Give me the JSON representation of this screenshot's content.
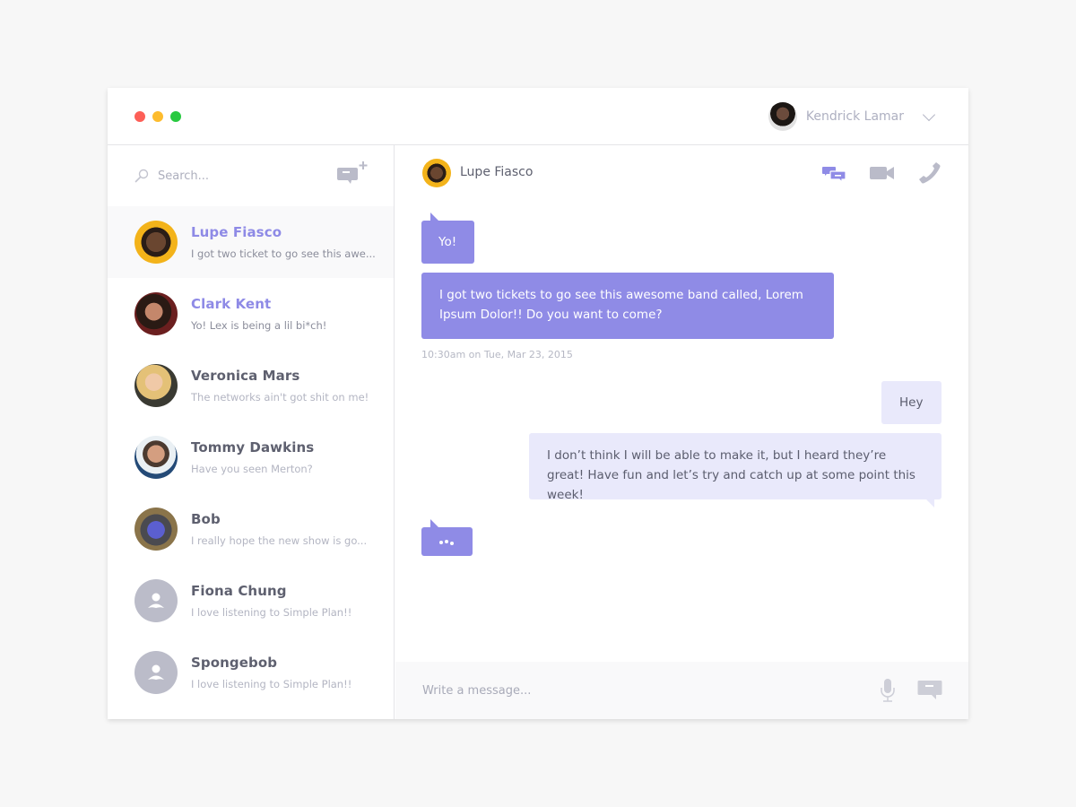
{
  "window": {
    "controls": [
      "close",
      "minimize",
      "maximize"
    ],
    "colors": {
      "close": "#fd5f57",
      "minimize": "#fdbc2e",
      "maximize": "#28c940"
    }
  },
  "user": {
    "name": "Kendrick Lamar",
    "menu_icon": "chevron-down-icon"
  },
  "sidebar": {
    "search": {
      "placeholder": "Search...",
      "value": ""
    },
    "new_chat_icon": "new-chat-icon",
    "contacts": [
      {
        "name": "Lupe Fiasco",
        "preview": "I got two ticket to go see this awe...",
        "active": true,
        "unread": true
      },
      {
        "name": "Clark Kent",
        "preview": "Yo! Lex is being a lil bi*ch!",
        "active": false,
        "unread": true
      },
      {
        "name": "Veronica Mars",
        "preview": "The networks ain't got shit on me!",
        "active": false,
        "unread": false
      },
      {
        "name": "Tommy Dawkins",
        "preview": "Have you seen Merton?",
        "active": false,
        "unread": false
      },
      {
        "name": "Bob",
        "preview": "I really hope the new show is go...",
        "active": false,
        "unread": false
      },
      {
        "name": "Fiona Chung",
        "preview": "I love listening to Simple Plan!!",
        "active": false,
        "unread": false
      },
      {
        "name": "Spongebob",
        "preview": "I love listening to Simple Plan!!",
        "active": false,
        "unread": false
      }
    ]
  },
  "chat": {
    "contact_name": "Lupe Fiasco",
    "actions": [
      "chat-icon",
      "video-camera-icon",
      "phone-icon"
    ],
    "messages": [
      {
        "from": "them",
        "text": "Yo!"
      },
      {
        "from": "them",
        "text": "I got two tickets to go see this awesome band called, Lorem Ipsum Dolor!! Do you want to come?"
      },
      {
        "from": "me",
        "text": "Hey"
      },
      {
        "from": "me",
        "text": "I don’t think I will be able to make it, but I heard they’re great! Have fun and let’s try and catch up at some point this week!"
      }
    ],
    "timestamp": "10:30am on Tue, Mar 23, 2015",
    "typing_indicator": "...",
    "composer": {
      "placeholder": "Write a message...",
      "value": ""
    }
  },
  "colors": {
    "accent": "#8f8be6",
    "outgoing_bubble": "#e9e9fb",
    "icon_gray": "#b9bac8"
  }
}
